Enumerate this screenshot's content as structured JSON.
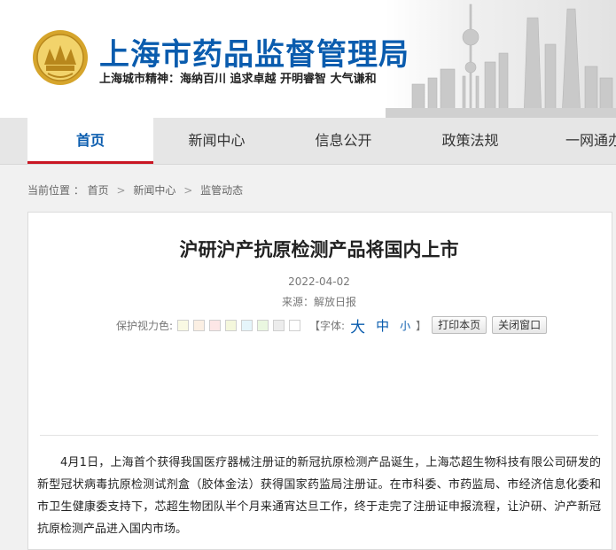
{
  "header": {
    "title": "上海市药品监督管理局",
    "slogan": "上海城市精神：海纳百川  追求卓越  开明睿智  大气谦和",
    "emblem_icon": "shanghai-emblem-icon",
    "colors": {
      "title": "#0a5cae",
      "emblem_gold": "#d6a52c",
      "nav_active": "#c91623"
    }
  },
  "nav": {
    "items": [
      {
        "label": "首页",
        "active": true
      },
      {
        "label": "新闻中心",
        "active": false
      },
      {
        "label": "信息公开",
        "active": false
      },
      {
        "label": "政策法规",
        "active": false
      },
      {
        "label": "一网通办",
        "active": false
      }
    ]
  },
  "breadcrumb": {
    "prefix": "当前位置 ：",
    "items": [
      "首页",
      "新闻中心",
      "监管动态"
    ],
    "separator": ">"
  },
  "article": {
    "title": "沪研沪产抗原检测产品将国内上市",
    "date": "2022-04-02",
    "source": "来源：解放日报",
    "eye_protect_label": "保护视力色:",
    "eye_colors": [
      "#f9f9e3",
      "#fbefe3",
      "#fde6e6",
      "#f4f7dc",
      "#e5f5fb",
      "#eaf7e0",
      "#ececec",
      "#ffffff"
    ],
    "font_label_open": "【字体:",
    "font_large": "大",
    "font_medium": "中",
    "font_small": "小",
    "font_label_close": "】",
    "print_button": "打印本页",
    "close_button": "关闭窗口",
    "body": "4月1日，上海首个获得我国医疗器械注册证的新冠抗原检测产品诞生，上海芯超生物科技有限公司研发的新型冠状病毒抗原检测试剂盒（胶体金法）获得国家药监局注册证。在市科委、市药监局、市经济信息化委和市卫生健康委支持下，芯超生物团队半个月来通宵达旦工作，终于走完了注册证申报流程，让沪研、沪产新冠抗原检测产品进入国内市场。"
  }
}
